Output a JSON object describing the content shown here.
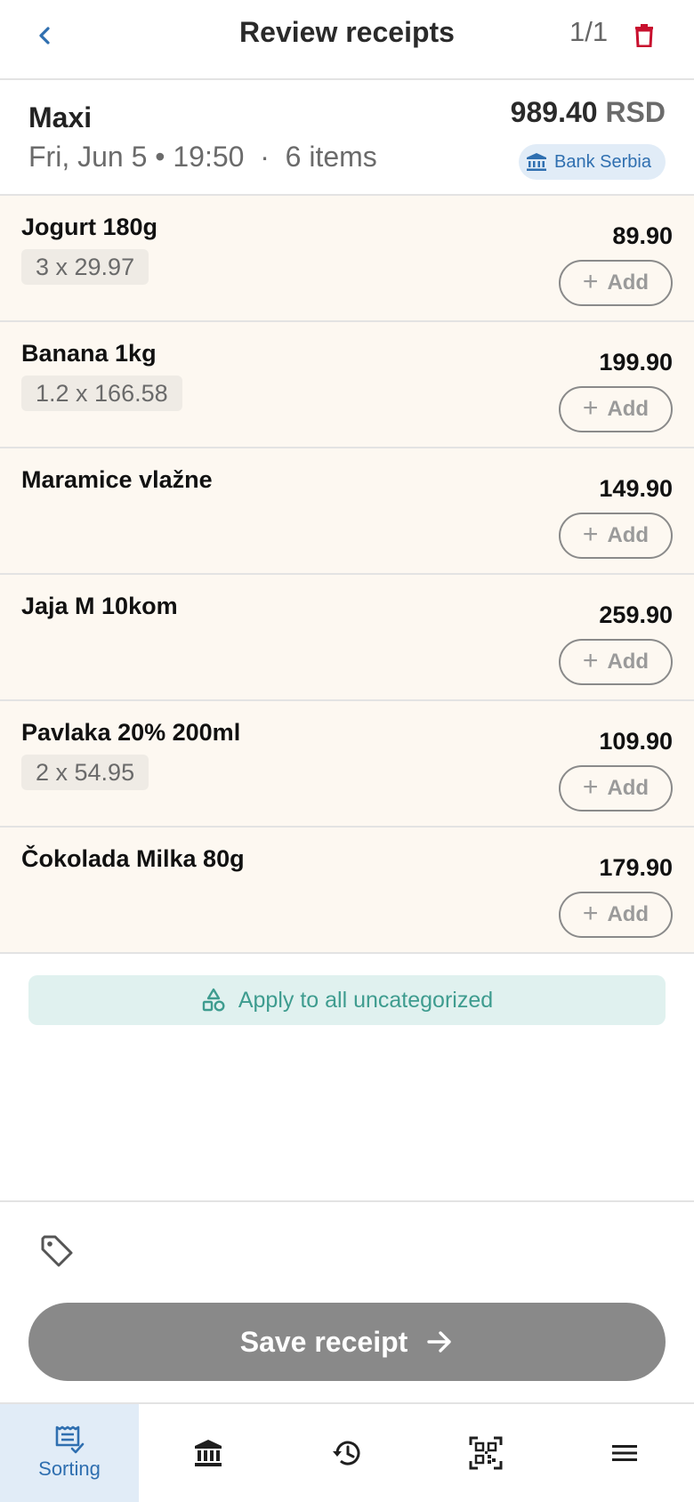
{
  "header": {
    "title": "Review receipts",
    "counter": "1/1"
  },
  "store": {
    "name": "Maxi",
    "meta": "Fri, Jun 5 • 19:50  ·  6 items",
    "total_amount": "989.40",
    "total_currency": "RSD",
    "bank": "Bank Serbia"
  },
  "items": [
    {
      "name": "Jogurt 180g",
      "qty": "3 x 29.97",
      "price": "89.90",
      "add_label": "Add"
    },
    {
      "name": "Banana 1kg",
      "qty": "1.2 x 166.58",
      "price": "199.90",
      "add_label": "Add"
    },
    {
      "name": "Maramice vlažne",
      "qty": "",
      "price": "149.90",
      "add_label": "Add"
    },
    {
      "name": "Jaja M 10kom",
      "qty": "",
      "price": "259.90",
      "add_label": "Add"
    },
    {
      "name": "Pavlaka 20% 200ml",
      "qty": "2 x 54.95",
      "price": "109.90",
      "add_label": "Add"
    },
    {
      "name": "Čokolada Milka 80g",
      "qty": "",
      "price": "179.90",
      "add_label": "Add"
    }
  ],
  "apply_all_label": "Apply to all uncategorized",
  "save_label": "Save receipt",
  "nav": {
    "sorting_label": "Sorting",
    "items": [
      "sorting-icon",
      "bank-icon",
      "history-icon",
      "qr-code-icon",
      "menu-icon"
    ]
  },
  "colors": {
    "accent": "#2f6fb0",
    "delete": "#c8102e",
    "item_bg": "#fdf8f1",
    "apply_bg": "#e0f1ef",
    "save_bg": "#898989"
  }
}
